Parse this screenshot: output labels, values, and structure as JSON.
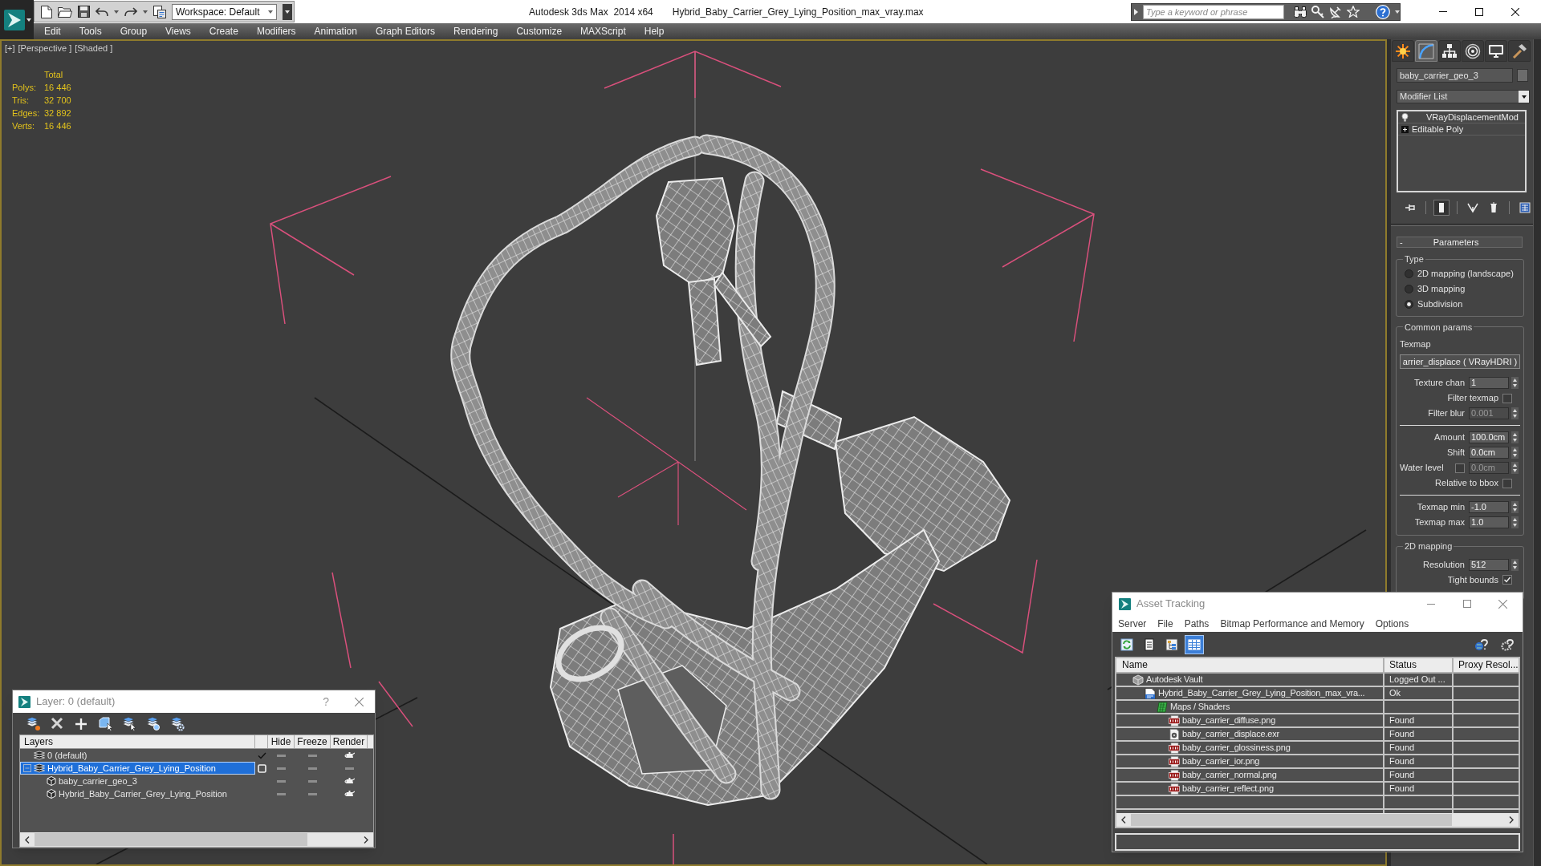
{
  "window": {
    "app_title": "Autodesk 3ds Max  2014 x64",
    "file_title": "Hybrid_Baby_Carrier_Grey_Lying_Position_max_vray.max"
  },
  "toolbar": {
    "workspace": "Workspace: Default"
  },
  "search": {
    "placeholder": "Type a keyword or phrase"
  },
  "menu": [
    "Edit",
    "Tools",
    "Group",
    "Views",
    "Create",
    "Modifiers",
    "Animation",
    "Graph Editors",
    "Rendering",
    "Customize",
    "MAXScript",
    "Help"
  ],
  "viewport": {
    "active": true,
    "labels": [
      "[+]",
      "[Perspective ]",
      "[Shaded ]"
    ],
    "stats": {
      "header": "Total",
      "rows": [
        {
          "label": "Polys:",
          "value": "16 446"
        },
        {
          "label": "Tris:",
          "value": "32 700"
        },
        {
          "label": "Edges:",
          "value": "32 892"
        },
        {
          "label": "Verts:",
          "value": "16 446"
        }
      ]
    }
  },
  "command_panel": {
    "tabs": [
      {
        "selected": false
      },
      {
        "selected": true
      },
      {
        "selected": false
      },
      {
        "selected": false
      },
      {
        "selected": false
      },
      {
        "selected": false
      }
    ],
    "object_name": "baby_carrier_geo_3",
    "modifier_list": "Modifier List",
    "stack": [
      {
        "kind": "modifier",
        "name": "VRayDisplacementMod",
        "enabled": true
      },
      {
        "kind": "base",
        "name": "Editable Poly",
        "expanded": false
      }
    ],
    "stack_tools": [
      {
        "selected": false
      },
      {
        "selected": true
      },
      {
        "selected": false
      },
      {
        "selected": false
      },
      {
        "selected": false
      }
    ],
    "rollout": {
      "toggle": "-",
      "title": "Parameters"
    },
    "type_group": {
      "title": "Type",
      "options": [
        {
          "label": "2D mapping (landscape)",
          "selected": false
        },
        {
          "label": "3D mapping",
          "selected": false
        },
        {
          "label": "Subdivision",
          "selected": true
        }
      ]
    },
    "common_group": {
      "title": "Common params",
      "texmap_label": "Texmap",
      "texmap_button": "arrier_displace ( VRayHDRI )",
      "params": [
        {
          "kind": "spinner",
          "label": "Texture chan",
          "value": "1",
          "disabled": false
        },
        {
          "kind": "checkbox",
          "label": "Filter texmap",
          "checked": false
        },
        {
          "kind": "spinner",
          "label": "Filter blur",
          "value": "0.001",
          "disabled": true
        },
        {
          "kind": "separator"
        },
        {
          "kind": "spinner",
          "label": "Amount",
          "value": "100.0cm",
          "disabled": false
        },
        {
          "kind": "spinner",
          "label": "Shift",
          "value": "0.0cm",
          "disabled": false
        },
        {
          "kind": "check_spinner",
          "label": "Water level",
          "checked": false,
          "value": "0.0cm",
          "disabled": true
        },
        {
          "kind": "checkbox",
          "label": "Relative to bbox",
          "checked": false
        },
        {
          "kind": "separator"
        },
        {
          "kind": "spinner",
          "label": "Texmap min",
          "value": "-1.0",
          "disabled": false
        },
        {
          "kind": "spinner",
          "label": "Texmap max",
          "value": "1.0",
          "disabled": false
        }
      ]
    },
    "mapping_group": {
      "title": "2D mapping",
      "params": [
        {
          "kind": "spinner",
          "label": "Resolution",
          "value": "512",
          "disabled": false
        },
        {
          "kind": "checkbox",
          "label": "Tight bounds",
          "checked": true
        }
      ]
    }
  },
  "layer_dialog": {
    "title": "Layer: 0 (default)",
    "help": "?",
    "columns": [
      "Layers",
      "Hide",
      "Freeze",
      "Render"
    ],
    "layers": [
      {
        "kind": "layer",
        "name": "0 (default)",
        "selected": false,
        "current": true,
        "hidden": false,
        "frozen": false,
        "renderable": true
      },
      {
        "kind": "layer",
        "name": "Hybrid_Baby_Carrier_Grey_Lying_Position",
        "selected": true,
        "current": false,
        "expanded": true,
        "hidden": false,
        "frozen": false,
        "renderable": false,
        "children": [
          {
            "kind": "object",
            "name": "baby_carrier_geo_3",
            "selected": false,
            "hidden": false,
            "frozen": false,
            "renderable": true
          },
          {
            "kind": "object",
            "name": "Hybrid_Baby_Carrier_Grey_Lying_Position",
            "selected": false,
            "hidden": false,
            "frozen": false,
            "renderable": true
          }
        ]
      }
    ]
  },
  "asset_tracking": {
    "title": "Asset Tracking",
    "menu": [
      "Server",
      "File",
      "Paths",
      "Bitmap Performance and Memory",
      "Options"
    ],
    "toolbar": [
      {
        "selected": false
      },
      {
        "selected": false
      },
      {
        "selected": false
      },
      {
        "selected": true
      }
    ],
    "columns": [
      "Name",
      "Status",
      "Proxy Resol..."
    ],
    "assets": [
      {
        "kind": "vault",
        "name": "Autodesk Vault",
        "status": "Logged Out ...",
        "children": [
          {
            "kind": "max_file",
            "name": "Hybrid_Baby_Carrier_Grey_Lying_Position_max_vra...",
            "status": "Ok",
            "children": [
              {
                "kind": "folder",
                "name": "Maps / Shaders",
                "children": [
                  {
                    "kind": "png",
                    "name": "baby_carrier_diffuse.png",
                    "status": "Found"
                  },
                  {
                    "kind": "exr",
                    "name": "baby_carrier_displace.exr",
                    "status": "Found"
                  },
                  {
                    "kind": "png",
                    "name": "baby_carrier_glossiness.png",
                    "status": "Found"
                  },
                  {
                    "kind": "png",
                    "name": "baby_carrier_ior.png",
                    "status": "Found"
                  },
                  {
                    "kind": "png",
                    "name": "baby_carrier_normal.png",
                    "status": "Found"
                  },
                  {
                    "kind": "png",
                    "name": "baby_carrier_reflect.png",
                    "status": "Found"
                  }
                ]
              }
            ]
          }
        ]
      }
    ]
  }
}
